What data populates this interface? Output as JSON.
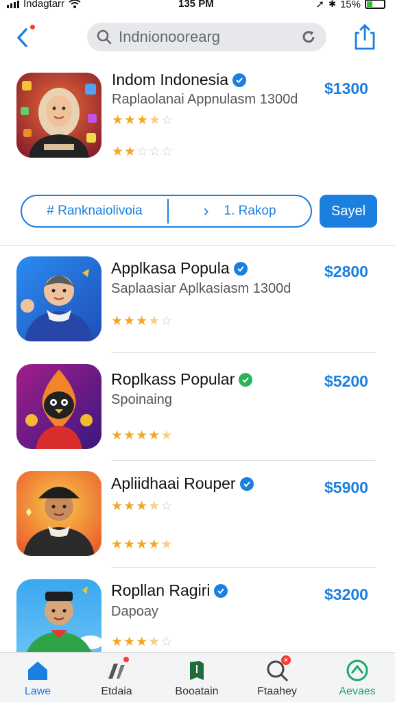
{
  "status_bar": {
    "carrier": "Indagtarr",
    "time": "135 PM",
    "battery": "15%"
  },
  "search": {
    "value": "Indnionoorearg"
  },
  "featured": {
    "title": "Indom Indonesia",
    "subtitle": "Raplaolanai Appnulasm 1300d",
    "price": "$1300",
    "rating_top": 3.5,
    "rating_bottom": 2
  },
  "filter": {
    "left_label": "# Ranknaiolivoia",
    "right_arrow": "›",
    "right_label": "1. Rakop"
  },
  "save_button": "Sayel",
  "apps": [
    {
      "title": "Applkasa Popula",
      "subtitle": "Saplaasiar Aplkasiasm 1300d",
      "price": "$2800",
      "rating": 3.5,
      "rating2": null,
      "verified_color": "#1b7fe0"
    },
    {
      "title": "Roplkass Popular",
      "subtitle": "Spoinaing",
      "price": "$5200",
      "rating": 4.5,
      "rating2": null,
      "verified_color": "#2bb35a"
    },
    {
      "title": "Apliidhaai Rouper",
      "subtitle": "",
      "price": "$5900",
      "rating": 3.5,
      "rating2": 4.5,
      "verified_color": "#1b7fe0"
    },
    {
      "title": "Ropllan Ragiri",
      "subtitle": "Dapoay",
      "price": "$3200",
      "rating": 3.5,
      "rating2": null,
      "verified_color": "#1b7fe0"
    }
  ],
  "tabs": [
    {
      "label": "Lawe",
      "icon": "home-icon",
      "active": true
    },
    {
      "label": "Etdaia",
      "icon": "games-icon",
      "active": false
    },
    {
      "label": "Booatain",
      "icon": "bookmark-icon",
      "active": false
    },
    {
      "label": "Ftaahey",
      "icon": "search-icon",
      "active": false
    },
    {
      "label": "Aevaes",
      "icon": "updates-icon",
      "active": false
    }
  ],
  "colors": {
    "accent": "#1b7fe0",
    "star": "#f2a824",
    "active_tab": "#1aa86b"
  }
}
